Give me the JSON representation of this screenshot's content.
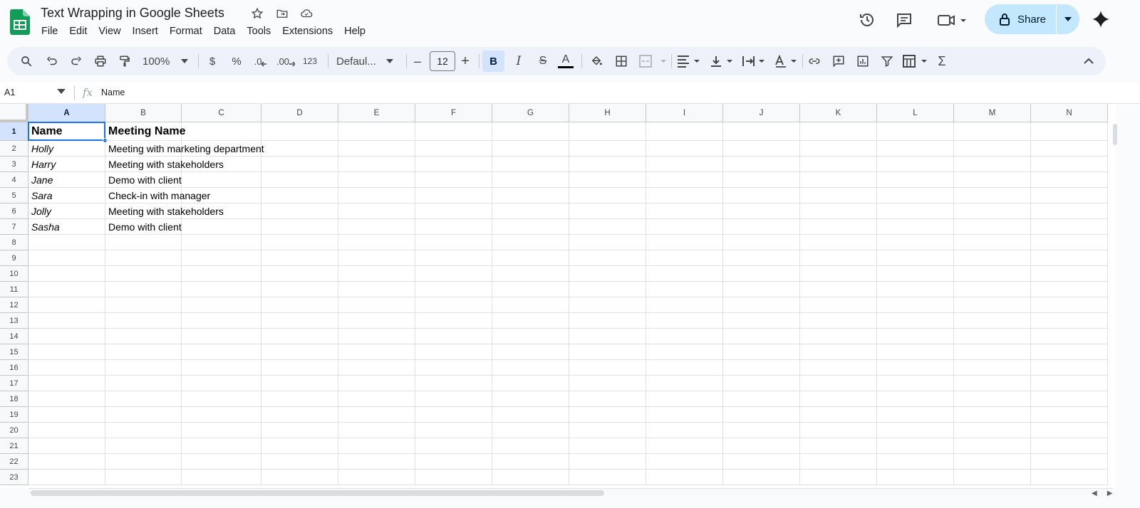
{
  "app": {
    "title": "Text Wrapping in Google Sheets",
    "accent": "#0f9d58"
  },
  "menu": [
    "File",
    "Edit",
    "View",
    "Insert",
    "Format",
    "Data",
    "Tools",
    "Extensions",
    "Help"
  ],
  "share": {
    "label": "Share",
    "bg": "#c2e7ff"
  },
  "toolbar": {
    "zoom": "100%",
    "currency": "$",
    "percent": "%",
    "dec_decrease": ".0",
    "dec_increase": ".00",
    "number_format": "123",
    "font": "Defaul...",
    "font_size": "12",
    "minus": "–",
    "plus": "+",
    "bold": "B",
    "italic": "I",
    "strike": "S",
    "text_color": "A",
    "sigma": "Σ"
  },
  "formula_bar": {
    "name_box": "A1",
    "fx": "fx",
    "content": "Name"
  },
  "grid": {
    "columns": [
      "A",
      "B",
      "C",
      "D",
      "E",
      "F",
      "G",
      "H",
      "I",
      "J",
      "K",
      "L",
      "M",
      "N"
    ],
    "rows": [
      "1",
      "2",
      "3",
      "4",
      "5",
      "6",
      "7",
      "8",
      "9",
      "10",
      "11",
      "12",
      "13",
      "14",
      "15",
      "16",
      "17",
      "18",
      "19",
      "20",
      "21",
      "22",
      "23"
    ],
    "header": [
      "Name",
      "Meeting Name"
    ],
    "data": [
      [
        "Holly",
        "Meeting with marketing department"
      ],
      [
        "Harry",
        "Meeting with stakeholders"
      ],
      [
        "Jane",
        "Demo with client"
      ],
      [
        "Sara",
        "Check-in with manager"
      ],
      [
        "Jolly",
        "Meeting with stakeholders"
      ],
      [
        "Sasha",
        "Demo with client"
      ]
    ],
    "selected_cell": "A1"
  },
  "icons": [
    "sheets-logo-icon",
    "star-icon",
    "move-folder-icon",
    "cloud-saved-icon",
    "history-icon",
    "comment-icon",
    "meet-video-icon",
    "lock-icon",
    "gemini-sparkle-icon",
    "search-icon",
    "undo-icon",
    "redo-icon",
    "print-icon",
    "paint-format-icon",
    "fill-color-icon",
    "borders-icon",
    "merge-icon",
    "align-left-icon",
    "vertical-align-icon",
    "text-wrap-icon",
    "text-rotation-icon",
    "link-icon",
    "add-comment-icon",
    "chart-icon",
    "filter-icon",
    "filter-views-icon",
    "functions-icon",
    "collapse-icon"
  ]
}
